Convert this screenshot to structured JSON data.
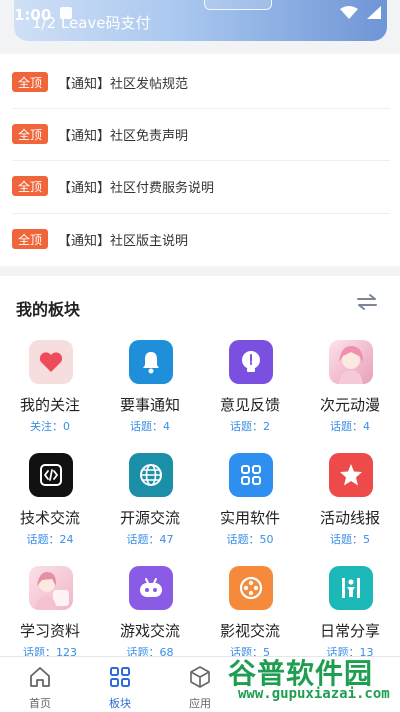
{
  "status": {
    "time": "1:00",
    "banner_text": "1/2 Leave码支付"
  },
  "notices": [
    {
      "badge": "全顶",
      "text": "【通知】社区发帖规范"
    },
    {
      "badge": "全顶",
      "text": "【通知】社区免责声明"
    },
    {
      "badge": "全顶",
      "text": "【通知】社区付费服务说明"
    },
    {
      "badge": "全顶",
      "text": "【通知】社区版主说明"
    }
  ],
  "section": {
    "title": "我的板块",
    "icon": "swap-icon"
  },
  "boards": [
    {
      "name": "我的关注",
      "meta": "关注：0",
      "icon": "heart-icon",
      "color": "#f5d6d6"
    },
    {
      "name": "要事通知",
      "meta": "话题：4",
      "icon": "bell-icon",
      "color": "#1e8fd8"
    },
    {
      "name": "意见反馈",
      "meta": "话题：2",
      "icon": "lightbulb-icon",
      "color": "#7b4fe0"
    },
    {
      "name": "次元动漫",
      "meta": "话题：4",
      "icon": "anime-girl-icon",
      "color": "#f3c4d6"
    },
    {
      "name": "技术交流",
      "meta": "话题：24",
      "icon": "code-icon",
      "color": "#111111"
    },
    {
      "name": "开源交流",
      "meta": "话题：47",
      "icon": "globe-icon",
      "color": "#1c8fa8"
    },
    {
      "name": "实用软件",
      "meta": "话题：50",
      "icon": "apps-grid-icon",
      "color": "#2f8ff0"
    },
    {
      "name": "活动线报",
      "meta": "话题：5",
      "icon": "star-icon",
      "color": "#ee4a4a"
    },
    {
      "name": "学习资料",
      "meta": "话题：123",
      "icon": "anime-study-icon",
      "color": "#f0c2cf"
    },
    {
      "name": "游戏交流",
      "meta": "话题：68",
      "icon": "gamepad-icon",
      "color": "#8a5ce6"
    },
    {
      "name": "影视交流",
      "meta": "话题：5",
      "icon": "film-reel-icon",
      "color": "#f58a3c"
    },
    {
      "name": "日常分享",
      "meta": "话题：13",
      "icon": "person-icon",
      "color": "#1cb8b8"
    }
  ],
  "nav": [
    {
      "label": "首页",
      "icon": "home-icon"
    },
    {
      "label": "板块",
      "icon": "grid-icon"
    },
    {
      "label": "应用",
      "icon": "cube-icon"
    }
  ],
  "watermark": {
    "cn": "谷普软件园",
    "url": "www.gupuxiazai.com"
  }
}
